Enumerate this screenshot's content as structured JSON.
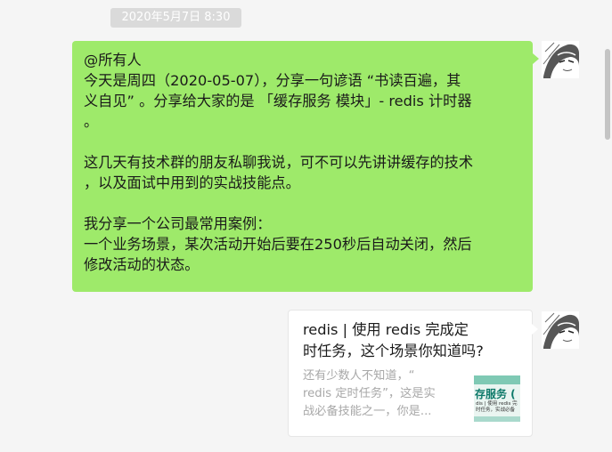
{
  "timestamp": "2020年5月7日 8:30",
  "message": {
    "lines": [
      "@所有人",
      "今天是周四（2020-05-07），分享一句谚语 “书读百遍，其",
      "义自见” 。分享给大家的是 「缓存服务 模块」- redis 计时器",
      "。",
      "",
      "这几天有技术群的朋友私聊我说，可不可以先讲讲缓存的技术",
      "，以及面试中用到的实战技能点。",
      "",
      "我分享一个公司最常用案例：",
      "一个业务场景，某次活动开始后要在250秒后自动关闭，然后",
      "修改活动的状态。"
    ]
  },
  "card": {
    "title_lines": [
      "redis | 使用 redis 完成定",
      "时任务，这个场景你知道吗?"
    ],
    "desc_lines": [
      "还有少数人不知道，“",
      "redis 定时任务”，这是实",
      "战必备技能之一，你是..."
    ],
    "thumb_title": "存服务 (",
    "thumb_sub_lines": [
      "dis | 使用 redis 完",
      "时任务，实战必备"
    ]
  },
  "colors": {
    "background": "#f5f5f5",
    "bubble_self": "#9eea6a",
    "card_bg": "#ffffff",
    "timestamp_bg": "#dadada"
  },
  "icons": {
    "avatar": "user-avatar-sketch"
  }
}
